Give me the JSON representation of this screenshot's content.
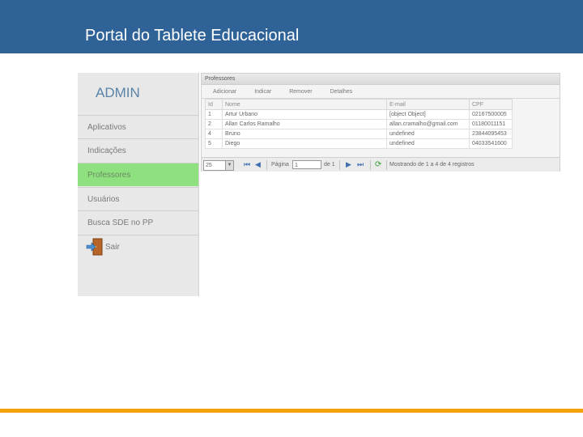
{
  "header": {
    "title": "Portal do Tablete Educacional"
  },
  "colors": {
    "header_bg": "#2f6398",
    "accent_line": "#f3a20c",
    "active_menu": "#8fe07e"
  },
  "sidebar": {
    "title": "ADMIN",
    "items": [
      {
        "label": "Aplicativos"
      },
      {
        "label": "Indicações"
      },
      {
        "label": "Professores",
        "active": true
      },
      {
        "label": "Usuários"
      },
      {
        "label": "Busca SDE no PP"
      },
      {
        "label": "Sair",
        "icon": "exit-door-icon"
      }
    ]
  },
  "panel": {
    "title": "Professores",
    "toolbar": [
      "Adicionar",
      "Indicar",
      "Remover",
      "Detalhes"
    ],
    "columns": [
      "Id",
      "Nome",
      "E-mail",
      "CPF"
    ],
    "rows": [
      [
        "1",
        "Artur Urbano",
        "[object Object]",
        "02167500005"
      ],
      [
        "2",
        "Allan Carlos Ramalho",
        "allan.cramalho@gmail.com",
        "01180011151"
      ],
      [
        "4",
        "Bruno",
        "undefined",
        "23844095453"
      ],
      [
        "5",
        "Diego",
        "undefined",
        "04033541600"
      ]
    ],
    "pager": {
      "page_size": "25",
      "page_label": "Página",
      "page_value": "1",
      "page_total": "de 1",
      "info": "Mostrando de 1 a 4 de 4 registros"
    }
  }
}
